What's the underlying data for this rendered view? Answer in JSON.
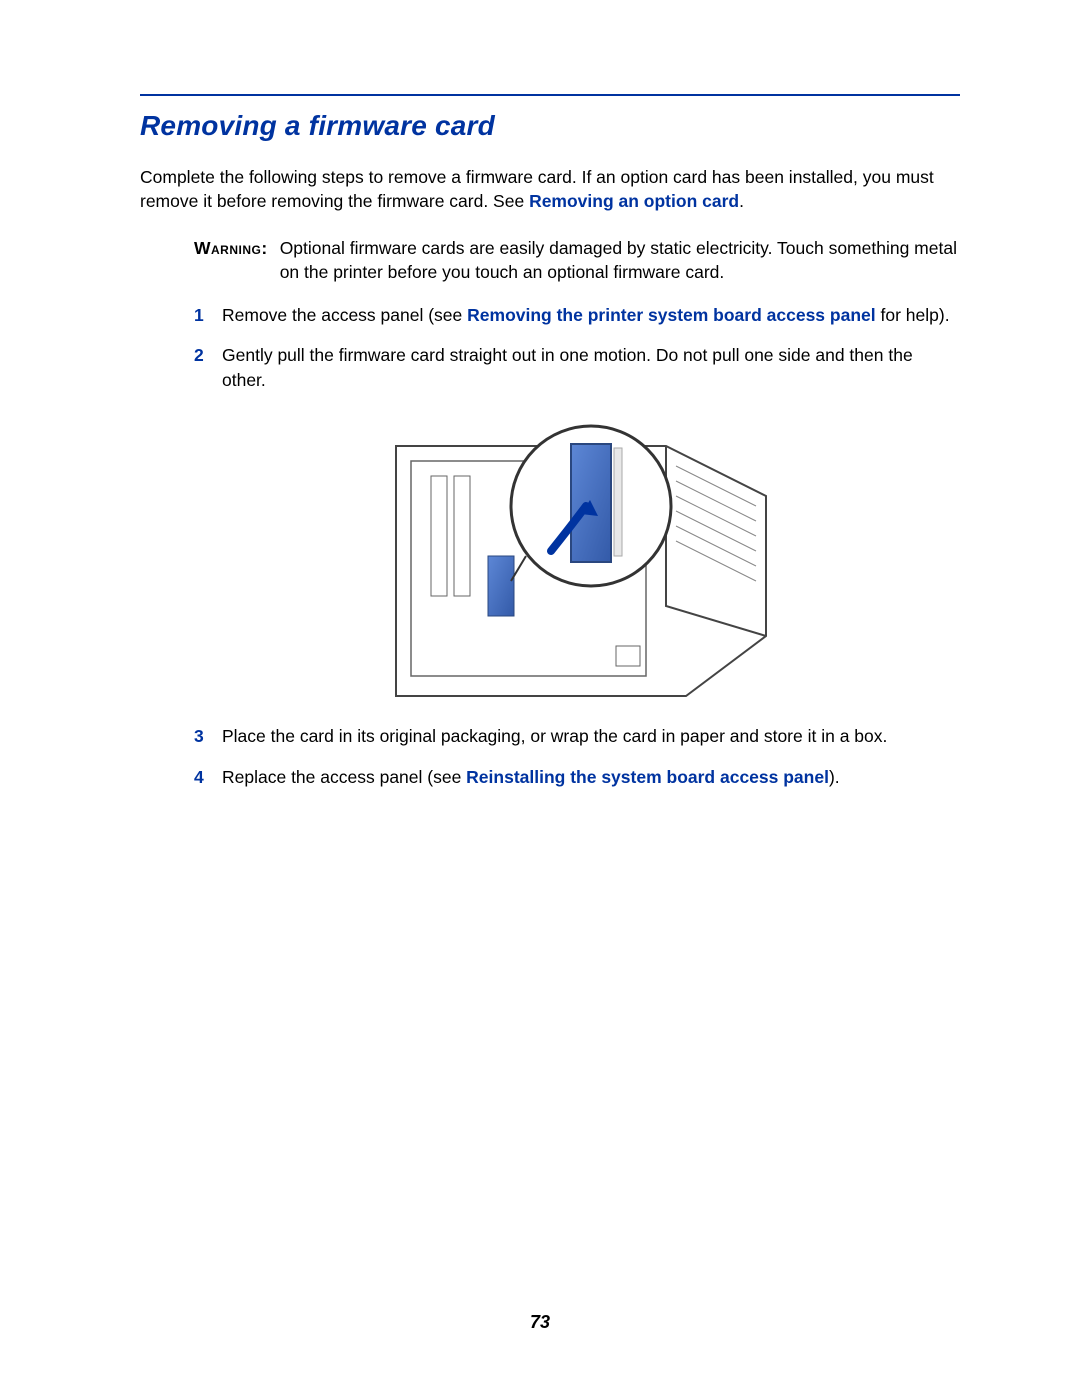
{
  "section_title": "Removing a firmware card",
  "intro": {
    "pre": "Complete the following steps to remove a firmware card. If an option card has been installed, you must remove it before removing the firmware card. See ",
    "xref": "Removing an option card",
    "post": "."
  },
  "warning": {
    "label": "Warning:",
    "text": "Optional firmware cards are easily damaged by static electricity. Touch something metal on the printer before you touch an optional firmware card."
  },
  "steps": {
    "s1": {
      "pre": "Remove the access panel (see ",
      "xref": "Removing the printer system board access panel",
      "post": " for help)."
    },
    "s2": {
      "text": "Gently pull the firmware card straight out in one motion. Do not pull one side and then the other."
    },
    "s3": {
      "text": "Place the card in its original packaging, or wrap the card in paper and store it in a box."
    },
    "s4": {
      "pre": "Replace the access panel (see ",
      "xref": "Reinstalling the system board access panel",
      "post": ")."
    }
  },
  "page_number": "73"
}
